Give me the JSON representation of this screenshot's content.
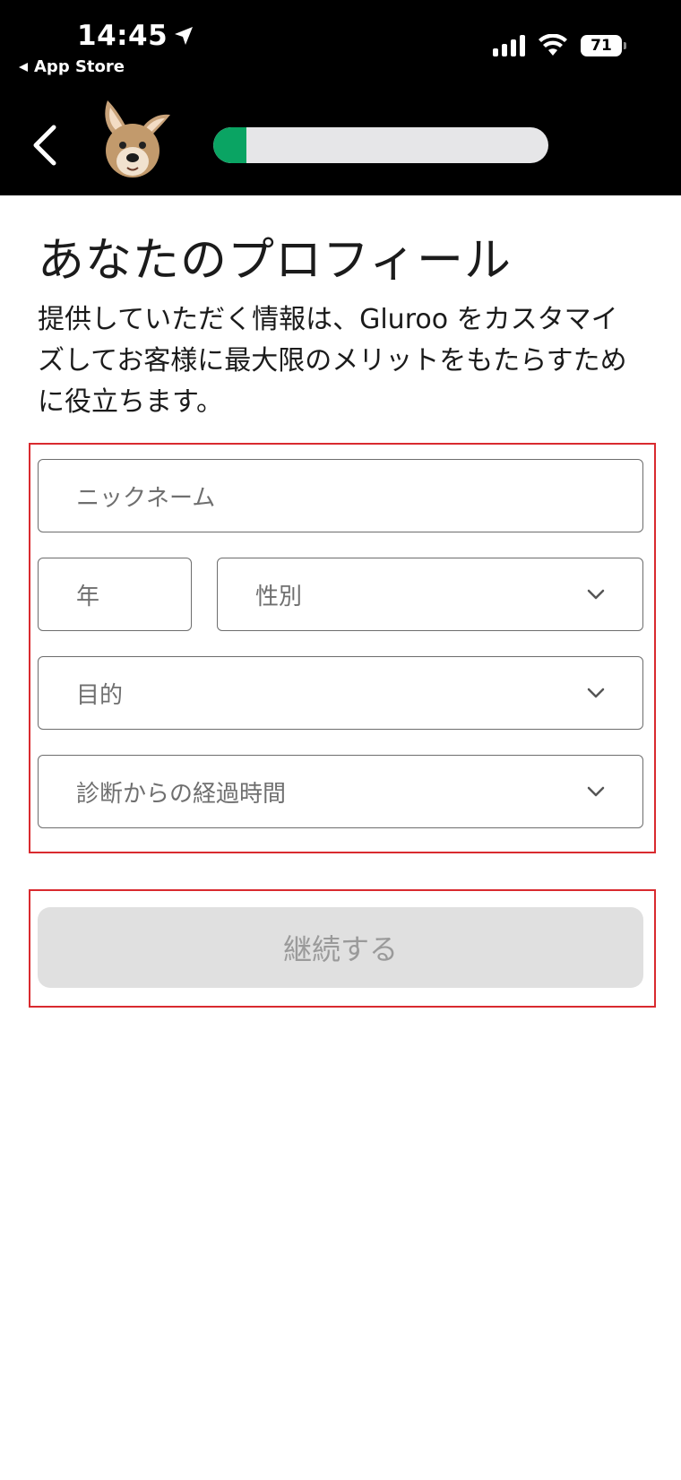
{
  "status_bar": {
    "time": "14:45",
    "back_app": "App Store",
    "battery": "71"
  },
  "header": {
    "progress_value": 0.1,
    "progress_color": "#0aa463",
    "mascot_icon": "kangaroo-mascot-icon"
  },
  "page": {
    "title": "あなたのプロフィール",
    "description": "提供していただく情報は、Gluroo をカスタマイズしてお客様に最大限のメリットをもたらすために役立ちます。"
  },
  "form": {
    "nickname_placeholder": "ニックネーム",
    "year_placeholder": "年",
    "gender_placeholder": "性別",
    "purpose_placeholder": "目的",
    "time_since_diagnosis_placeholder": "診断からの経過時間"
  },
  "actions": {
    "continue_label": "継続する"
  },
  "colors": {
    "highlight_border": "#d92a2f",
    "button_disabled_bg": "#e0e0e0"
  }
}
